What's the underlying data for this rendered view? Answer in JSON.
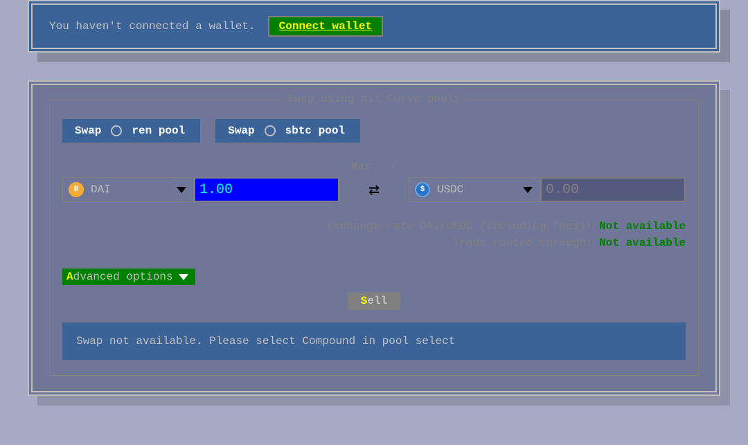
{
  "banner": {
    "text": "You haven't connected a wallet.",
    "connect_label": "Connect wallet"
  },
  "panel": {
    "legend": "Swap using all Curve pools",
    "pool_buttons": [
      {
        "swap_label": "Swap",
        "pool_label": "ren pool"
      },
      {
        "swap_label": "Swap",
        "pool_label": "sbtc pool"
      }
    ],
    "max_label": "Max:  /",
    "from": {
      "token": "DAI",
      "amount": "1.00"
    },
    "to": {
      "token": "USDC",
      "amount": "0.00"
    },
    "exchange_rate_label": "Exchange rate DAI/USDC  (including fees):",
    "exchange_rate_value": "Not available",
    "route_label": "Trade routed through:",
    "route_value": "Not available",
    "advanced_hot": "A",
    "advanced_rest": "dvanced options",
    "sell_hot": "S",
    "sell_rest": "ell",
    "notice": "Swap not available. Please select Compound in pool select"
  }
}
